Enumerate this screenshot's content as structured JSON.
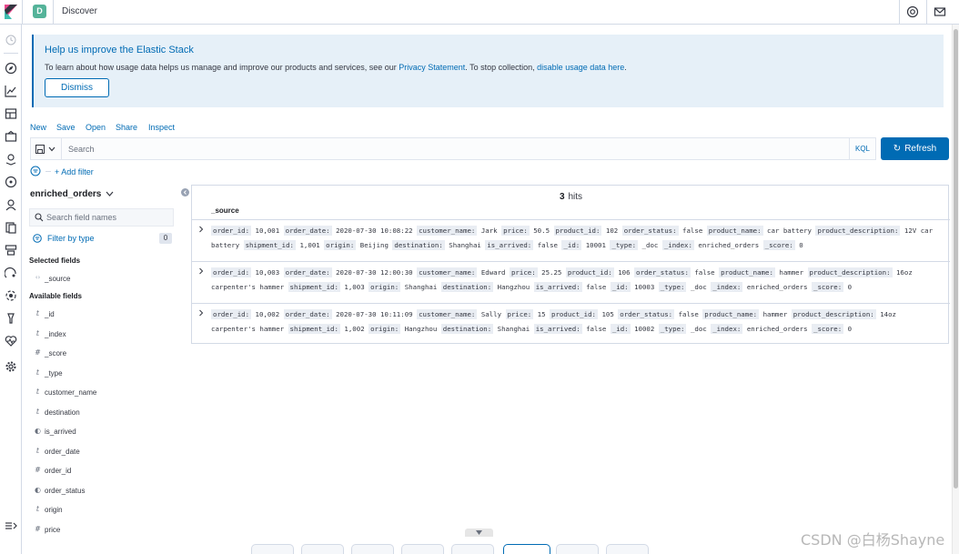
{
  "header": {
    "space_initial": "D",
    "title": "Discover"
  },
  "callout": {
    "title": "Help us improve the Elastic Stack",
    "text_before": "To learn about how usage data helps us manage and improve our products and services, see our ",
    "privacy_link": "Privacy Statement",
    "text_middle": ". To stop collection, ",
    "disable_link": "disable usage data here",
    "text_after": ".",
    "dismiss_label": "Dismiss"
  },
  "topnav": {
    "items": [
      "New",
      "Save",
      "Open",
      "Share",
      "Inspect"
    ]
  },
  "query": {
    "placeholder": "Search",
    "language": "KQL",
    "refresh_label": "Refresh"
  },
  "filters": {
    "add_filter_label": "+ Add filter"
  },
  "sidebar": {
    "index_pattern": "enriched_orders",
    "search_placeholder": "Search field names",
    "filter_by_type_label": "Filter by type",
    "filter_count": "0",
    "selected_heading": "Selected fields",
    "selected_fields": [
      {
        "type_glyph": "‹›",
        "name": "_source"
      }
    ],
    "available_heading": "Available fields",
    "available_fields": [
      {
        "type_glyph": "t",
        "name": "_id"
      },
      {
        "type_glyph": "t",
        "name": "_index"
      },
      {
        "type_glyph": "#",
        "name": "_score"
      },
      {
        "type_glyph": "t",
        "name": "_type"
      },
      {
        "type_glyph": "t",
        "name": "customer_name"
      },
      {
        "type_glyph": "t",
        "name": "destination"
      },
      {
        "type_glyph": "◐",
        "name": "is_arrived"
      },
      {
        "type_glyph": "t",
        "name": "order_date"
      },
      {
        "type_glyph": "#",
        "name": "order_id"
      },
      {
        "type_glyph": "◐",
        "name": "order_status"
      },
      {
        "type_glyph": "t",
        "name": "origin"
      },
      {
        "type_glyph": "#",
        "name": "price"
      }
    ]
  },
  "results": {
    "hits_count": "3",
    "hits_label": "hits",
    "source_column": "_source",
    "documents": [
      {
        "line1": [
          [
            "order_id:",
            "10,001"
          ],
          [
            "order_date:",
            "2020-07-30 10:08:22"
          ],
          [
            "customer_name:",
            "Jark"
          ],
          [
            "price:",
            "50.5"
          ],
          [
            "product_id:",
            "102"
          ],
          [
            "order_status:",
            "false"
          ],
          [
            "product_name:",
            "car battery"
          ],
          [
            "product_description:",
            "12V car"
          ]
        ],
        "line2": [
          [
            "",
            "battery"
          ],
          [
            "shipment_id:",
            "1,001"
          ],
          [
            "origin:",
            "Beijing"
          ],
          [
            "destination:",
            "Shanghai"
          ],
          [
            "is_arrived:",
            "false"
          ],
          [
            "_id:",
            "10001"
          ],
          [
            "_type:",
            "_doc"
          ],
          [
            "_index:",
            "enriched_orders"
          ],
          [
            "_score:",
            "0"
          ]
        ]
      },
      {
        "line1": [
          [
            "order_id:",
            "10,003"
          ],
          [
            "order_date:",
            "2020-07-30 12:00:30"
          ],
          [
            "customer_name:",
            "Edward"
          ],
          [
            "price:",
            "25.25"
          ],
          [
            "product_id:",
            "106"
          ],
          [
            "order_status:",
            "false"
          ],
          [
            "product_name:",
            "hammer"
          ],
          [
            "product_description:",
            "16oz"
          ]
        ],
        "line2": [
          [
            "",
            "carpenter's hammer"
          ],
          [
            "shipment_id:",
            "1,003"
          ],
          [
            "origin:",
            "Shanghai"
          ],
          [
            "destination:",
            "Hangzhou"
          ],
          [
            "is_arrived:",
            "false"
          ],
          [
            "_id:",
            "10003"
          ],
          [
            "_type:",
            "_doc"
          ],
          [
            "_index:",
            "enriched_orders"
          ],
          [
            "_score:",
            "0"
          ]
        ]
      },
      {
        "line1": [
          [
            "order_id:",
            "10,002"
          ],
          [
            "order_date:",
            "2020-07-30 10:11:09"
          ],
          [
            "customer_name:",
            "Sally"
          ],
          [
            "price:",
            "15"
          ],
          [
            "product_id:",
            "105"
          ],
          [
            "order_status:",
            "false"
          ],
          [
            "product_name:",
            "hammer"
          ],
          [
            "product_description:",
            "14oz"
          ]
        ],
        "line2": [
          [
            "",
            "carpenter's hammer"
          ],
          [
            "shipment_id:",
            "1,002"
          ],
          [
            "origin:",
            "Hangzhou"
          ],
          [
            "destination:",
            "Shanghai"
          ],
          [
            "is_arrived:",
            "false"
          ],
          [
            "_id:",
            "10002"
          ],
          [
            "_type:",
            "_doc"
          ],
          [
            "_index:",
            "enriched_orders"
          ],
          [
            "_score:",
            "0"
          ]
        ]
      }
    ]
  },
  "watermark": "CSDN @白杨Shayne",
  "colors": {
    "accent": "#006bb4",
    "callout_bg": "#e6f0f8",
    "space_badge": "#54b399",
    "border": "#d3dae6"
  }
}
